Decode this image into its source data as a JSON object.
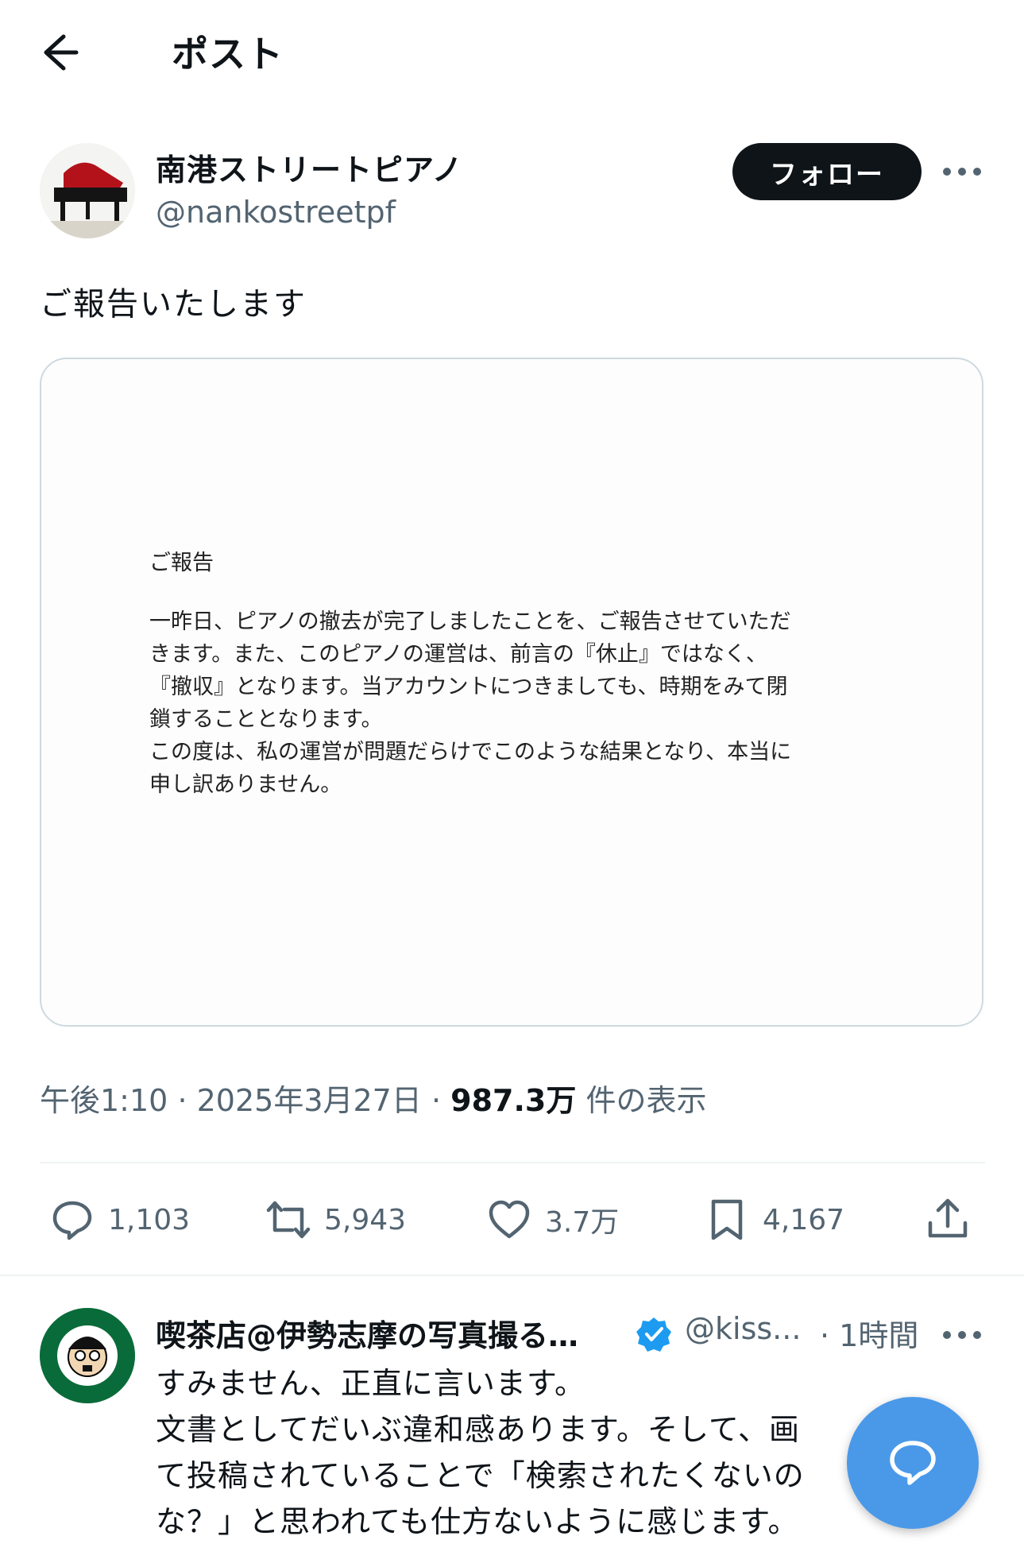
{
  "header": {
    "title": "ポスト"
  },
  "author": {
    "name": "南港ストリートピアノ",
    "handle": "@nankostreetpf",
    "follow_label": "フォロー"
  },
  "post": {
    "text": "ご報告いたします"
  },
  "document": {
    "title": "ご報告",
    "body": "一昨日、ピアノの撤去が完了しましたことを、ご報告させていただ\nきます。また、このピアノの運営は、前言の『休止』ではなく、\n『撤収』となります。当アカウントにつきましても、時期をみて閉\n鎖することとなります。\n この度は、私の運営が問題だらけでこのような結果となり、本当に\n申し訳ありません。"
  },
  "meta": {
    "time": "午後1:10",
    "sep1": "·",
    "date": "2025年3月27日",
    "sep2": "·",
    "views": "987.3万",
    "views_label": "件の表示"
  },
  "actions": {
    "replies": "1,103",
    "reposts": "5,943",
    "likes": "3.7万",
    "bookmarks": "4,167"
  },
  "reply": {
    "name": "喫茶店@伊勢志摩の写真撮る…",
    "handle": "@kiss...",
    "time": "· 1時間",
    "text": "すみません、正直に言います。\n文書としてだいぶ違和感あります。そして、画\nて投稿されていることで「検索されたくないの\nな？」と思われても仕方ないように感じます。"
  },
  "icons": [
    "back-arrow-icon",
    "more-icon",
    "reply-icon",
    "repost-icon",
    "like-icon",
    "bookmark-icon",
    "share-icon",
    "verified-icon",
    "compose-icon"
  ]
}
